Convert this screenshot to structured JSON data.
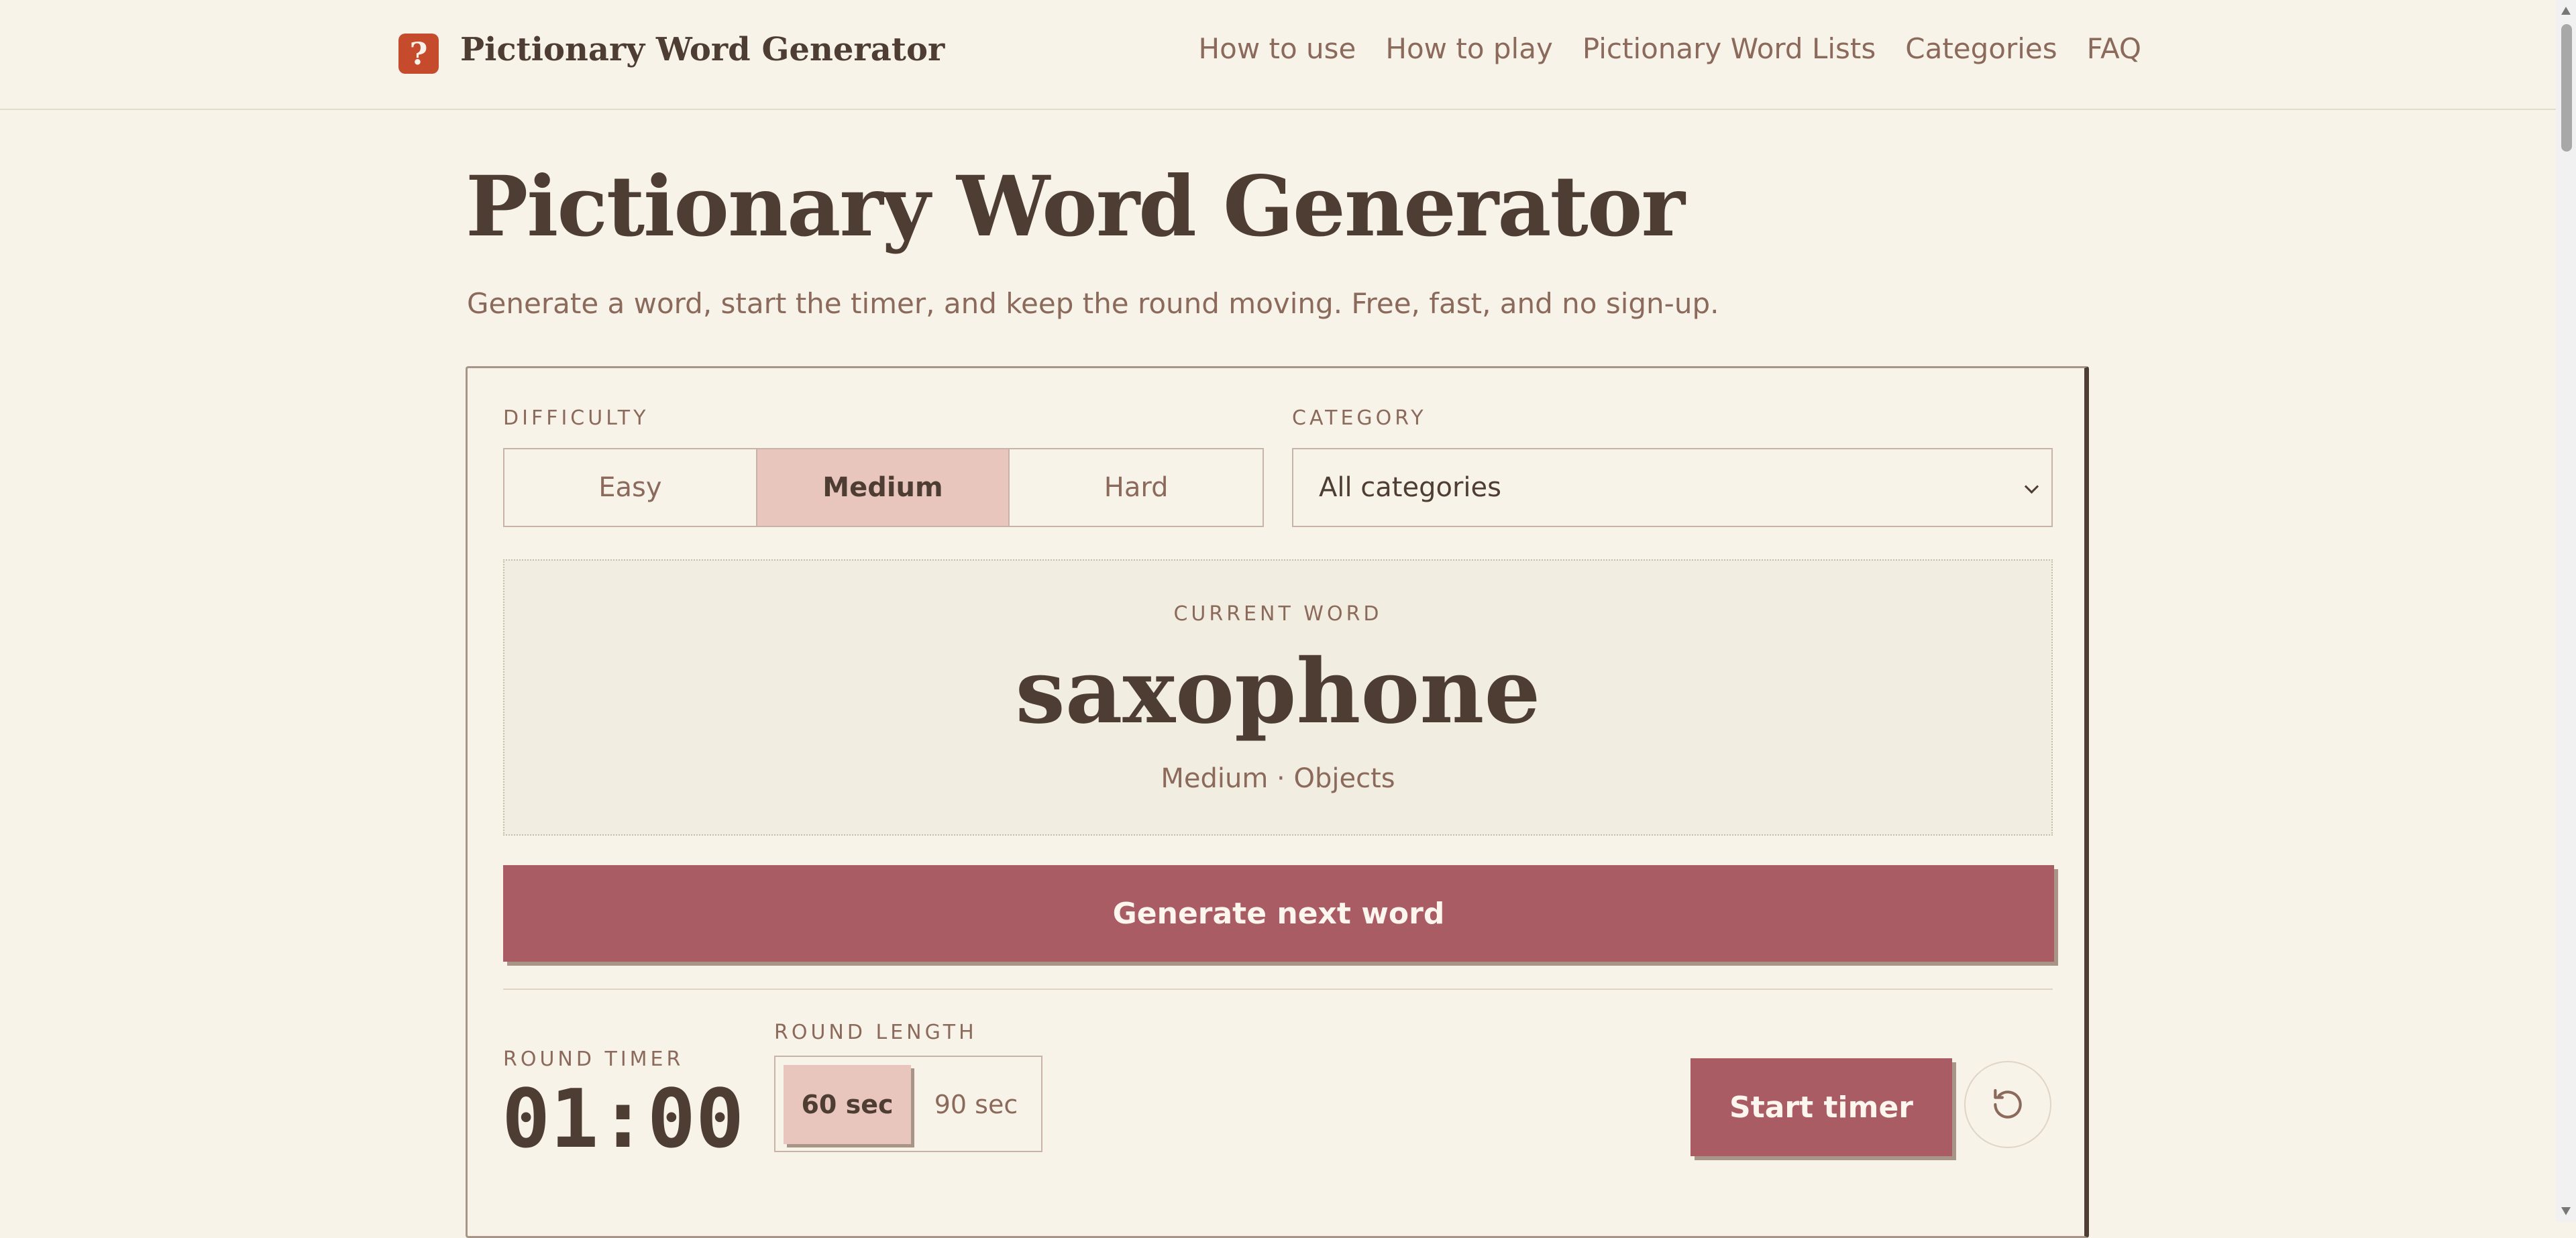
{
  "header": {
    "logo_glyph": "?",
    "brand": "Pictionary Word Generator",
    "nav": [
      "How to use",
      "How to play",
      "Pictionary Word Lists",
      "Categories",
      "FAQ"
    ]
  },
  "hero": {
    "title": "Pictionary Word Generator",
    "subtitle": "Generate a word, start the timer, and keep the round moving. Free, fast, and no sign-up."
  },
  "controls": {
    "difficulty_label": "DIFFICULTY",
    "difficulty_options": [
      "Easy",
      "Medium",
      "Hard"
    ],
    "difficulty_selected": "Medium",
    "category_label": "CATEGORY",
    "category_value": "All categories"
  },
  "word_card": {
    "label": "CURRENT WORD",
    "word": "saxophone",
    "meta": "Medium · Objects"
  },
  "generate_button": "Generate next word",
  "timer": {
    "label": "ROUND TIMER",
    "value": "01:00",
    "round_length_label": "ROUND LENGTH",
    "round_options": [
      "60 sec",
      "90 sec"
    ],
    "round_selected": "60 sec",
    "start_button": "Start timer",
    "reset_icon": "reset-icon"
  },
  "colors": {
    "background": "#f7f3e9",
    "accent": "#a95c64",
    "selected": "#e8c6bd",
    "text": "#4e3d33",
    "muted": "#8b6a5b",
    "logo": "#c64a2c"
  }
}
